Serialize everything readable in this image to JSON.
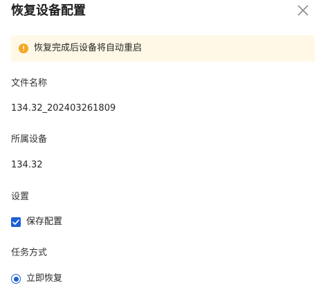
{
  "dialog": {
    "title": "恢复设备配置",
    "close_icon": "close-icon"
  },
  "alert": {
    "icon": "warning-circle-icon",
    "color": "#f5a623",
    "text": "恢复完成后设备将自动重启"
  },
  "fields": {
    "file_name": {
      "label": "文件名称",
      "value": "134.32_202403261809"
    },
    "device": {
      "label": "所属设备",
      "value": "134.32"
    },
    "settings": {
      "label": "设置",
      "option_label": "保存配置",
      "checked": true
    },
    "task_mode": {
      "label": "任务方式",
      "option_label": "立即恢复",
      "selected": true
    }
  },
  "colors": {
    "accent": "#1a5fd6",
    "alert_bg": "#fff8e6"
  }
}
